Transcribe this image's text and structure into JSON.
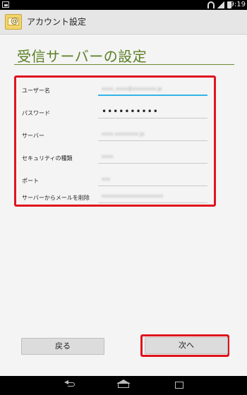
{
  "status_bar": {
    "time": "9:19"
  },
  "title_bar": {
    "title": "アカウント設定",
    "icon": "mail-app-icon"
  },
  "page": {
    "heading": "受信サーバーの設定"
  },
  "form": {
    "fields": [
      {
        "label": "ユーザー名",
        "value": "xxxx_xxxx@xxxxxxxx.jp",
        "focused": true
      },
      {
        "label": "パスワード",
        "value": "••••••••••"
      },
      {
        "label": "サーバー",
        "value": "xxxx.xxxxxxxx.jp"
      },
      {
        "label": "セキュリティの種類",
        "value": "xxxx"
      },
      {
        "label": "ポート",
        "value": "xxx"
      },
      {
        "label": "サーバーからメールを削除",
        "value": "xxxxxxxxxxxxxxxxxxxxx"
      }
    ]
  },
  "buttons": {
    "back": "戻る",
    "next": "次へ"
  },
  "colors": {
    "accent_green": "#5b7f24",
    "highlight_red": "#e0131d",
    "focus_blue": "#33b5e5"
  }
}
